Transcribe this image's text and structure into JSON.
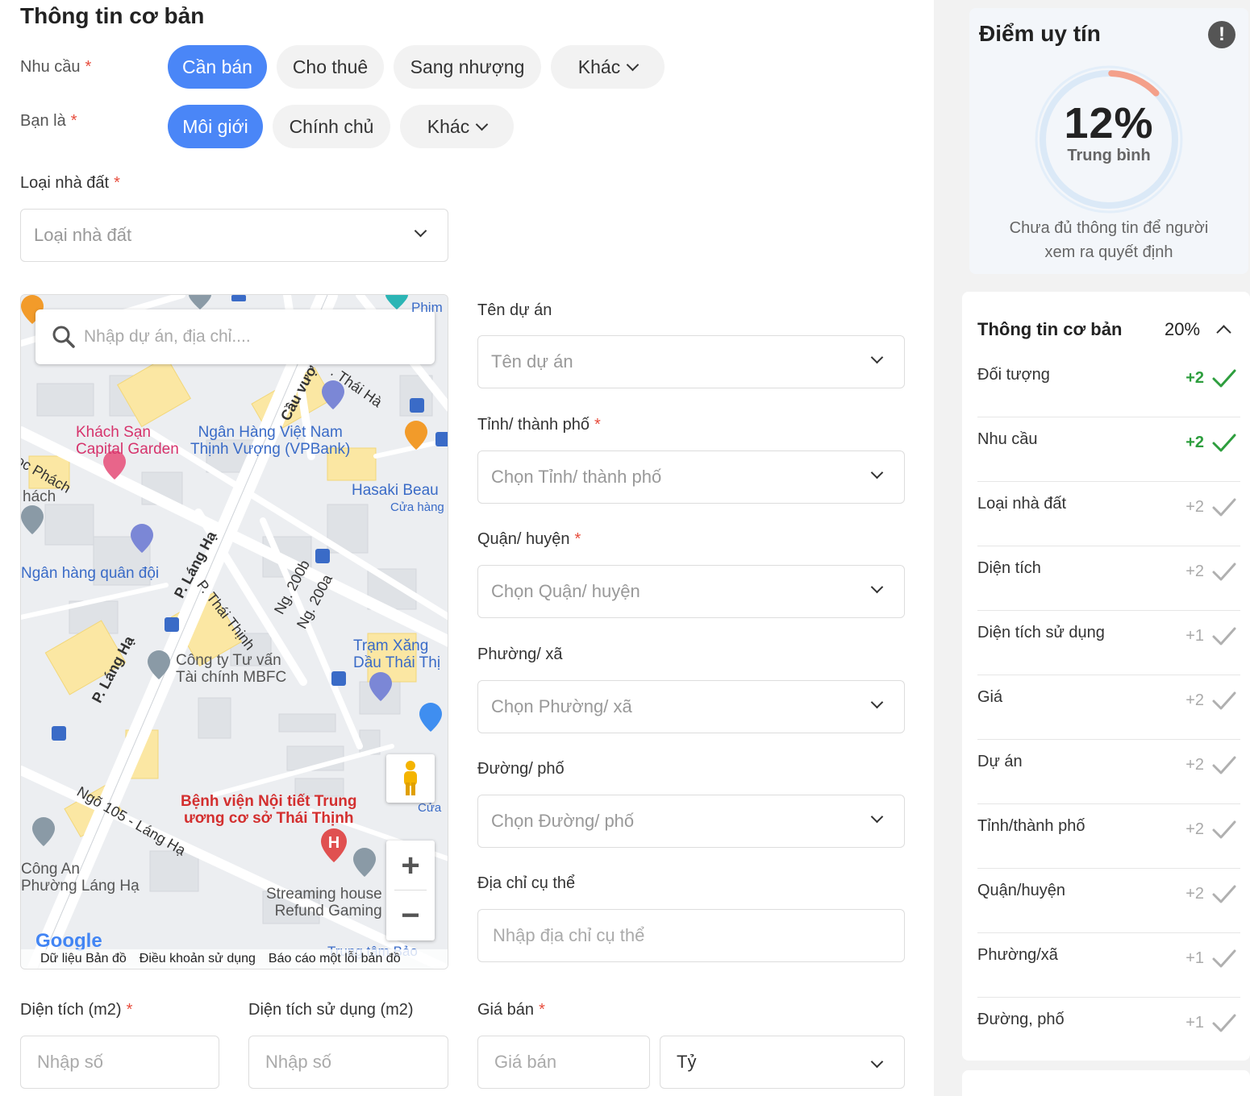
{
  "form": {
    "title": "Thông tin cơ bản",
    "need": {
      "label": "Nhu cầu",
      "required": "*",
      "options": [
        "Cần bán",
        "Cho thuê",
        "Sang nhượng"
      ],
      "more": "Khác"
    },
    "you_are": {
      "label": "Bạn là",
      "required": "*",
      "options": [
        "Môi giới",
        "Chính chủ"
      ],
      "more": "Khác"
    },
    "property_type": {
      "label": "Loại nhà đất",
      "required": "*",
      "placeholder": "Loại nhà đất"
    },
    "project": {
      "label": "Tên dự án",
      "placeholder": "Tên dự án"
    },
    "province": {
      "label": "Tỉnh/ thành phố",
      "required": "*",
      "placeholder": "Chọn Tỉnh/ thành phố"
    },
    "district": {
      "label": "Quận/ huyện",
      "required": "*",
      "placeholder": "Chọn Quận/ huyện"
    },
    "ward": {
      "label": "Phường/ xã",
      "placeholder": "Chọn Phường/ xã"
    },
    "street": {
      "label": "Đường/ phố",
      "placeholder": "Chọn Đường/ phố"
    },
    "address": {
      "label": "Địa chỉ cụ thể",
      "placeholder": "Nhập địa chỉ cụ thể"
    },
    "area": {
      "label": "Diện tích (m2)",
      "required": "*",
      "placeholder": "Nhập số"
    },
    "used_area": {
      "label": "Diện tích sử dụng (m2)",
      "placeholder": "Nhập số"
    },
    "price": {
      "label": "Giá bán",
      "required": "*",
      "placeholder": "Giá bán",
      "unit": "Tỷ"
    }
  },
  "map": {
    "search_placeholder": "Nhập dự án, địa chỉ....",
    "labels": {
      "hotel_1": "Khách Sạn",
      "hotel_2": "Capital Garden",
      "bank_1": "Ngân Hàng Việt Nam",
      "bank_2": "Thịnh Vượng (VPBank)",
      "hasaki": "Hasaki Beau",
      "hasaki_sub": "Cửa hàng",
      "mbbank": "Ngân hàng quân đội",
      "mbfc_1": "Công ty Tư vấn",
      "mbfc_2": "Tài chính MBFC",
      "gas_1": "Trạm Xăng",
      "gas_2": "Dầu Thái Thị",
      "hospital_1": "Bệnh viện Nội tiết Trung",
      "hospital_2": "ương cơ sở Thái Thịnh",
      "police_1": "Công An",
      "police_2": "Phường Láng Hạ",
      "stream_1": "Streaming house",
      "stream_2": "Refund Gaming",
      "road_langha_1": "P. Láng Hạ",
      "road_langha_2": "P. Láng Hạ",
      "road_thaithinh": "P. Thái Thịnh",
      "road_200b": "Ng. 200b",
      "road_200a": "Ng. 200a",
      "road_105": "Ngõ 105 - Láng Hạ",
      "road_cauvuc": "Cầu vượ",
      "road_thaiha": ". Thái Hà",
      "road_phach": "oc Phách",
      "phach": "hách",
      "phim": "Phim",
      "bottom_center": "Trung tâm Bảo",
      "cua": "Cửa",
      "google": "Google"
    },
    "footer": [
      "Dữ liệu Bản đồ",
      "Điều khoản sử dụng",
      "Báo cáo một lỗi bản đồ"
    ]
  },
  "score": {
    "title": "Điểm uy tín",
    "info_icon": "!",
    "value": 12,
    "value_text": "12%",
    "level": "Trung bình",
    "description": "Chưa đủ thông tin để người xem ra quyết định",
    "colors": {
      "arc": "#f4a08a",
      "ring": "#dbe9f7"
    }
  },
  "checklist": {
    "title": "Thông tin cơ bản",
    "percent": "20%",
    "items": [
      {
        "name": "Đối tượng",
        "points": "+2",
        "done": true
      },
      {
        "name": "Nhu cầu",
        "points": "+2",
        "done": true
      },
      {
        "name": "Loại nhà đất",
        "points": "+2",
        "done": false
      },
      {
        "name": "Diện tích",
        "points": "+2",
        "done": false
      },
      {
        "name": "Diện tích sử dụng",
        "points": "+1",
        "done": false
      },
      {
        "name": "Giá",
        "points": "+2",
        "done": false
      },
      {
        "name": "Dự án",
        "points": "+2",
        "done": false
      },
      {
        "name": "Tỉnh/thành phố",
        "points": "+2",
        "done": false
      },
      {
        "name": "Quận/huyện",
        "points": "+2",
        "done": false
      },
      {
        "name": "Phường/xã",
        "points": "+1",
        "done": false
      },
      {
        "name": "Đường, phố",
        "points": "+1",
        "done": false
      }
    ]
  },
  "colors": {
    "primary": "#4a86f7",
    "done": "#2e9e3e",
    "required": "#e74c3c"
  }
}
